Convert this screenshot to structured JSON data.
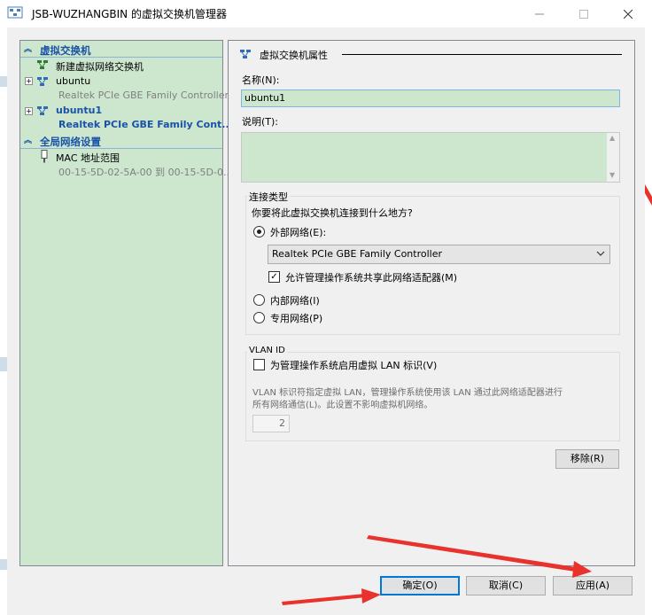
{
  "window": {
    "title": "JSB-WUZHANGBIN 的虚拟交换机管理器"
  },
  "left_panel": {
    "section1": {
      "label": "虚拟交换机"
    },
    "new_switch": {
      "label": "新建虚拟网络交换机"
    },
    "switches": [
      {
        "name": "ubuntu",
        "adapter": "Realtek PCIe GBE Family Controller"
      },
      {
        "name": "ubuntu1",
        "adapter": "Realtek PCIe GBE Family Cont..."
      }
    ],
    "section2": {
      "label": "全局网络设置"
    },
    "mac": {
      "label": "MAC 地址范围",
      "range": "00-15-5D-02-5A-00 到 00-15-5D-0..."
    }
  },
  "props": {
    "header": "虚拟交换机属性",
    "name_label": "名称(N):",
    "name_value": "ubuntu1",
    "desc_label": "说明(T):",
    "desc_value": "",
    "conn": {
      "title": "连接类型",
      "question": "你要将此虚拟交换机连接到什么地方?",
      "external": "外部网络(E):",
      "adapter_selected": "Realtek PCIe GBE Family Controller",
      "allow_mgmt": "允许管理操作系统共享此网络适配器(M)",
      "internal": "内部网络(I)",
      "private": "专用网络(P)",
      "selected": "external",
      "allow_mgmt_checked": true
    },
    "vlan": {
      "title": "VLAN ID",
      "enable": "为管理操作系统启用虚拟 LAN 标识(V)",
      "enable_checked": false,
      "desc_line1": "VLAN 标识符指定虚拟 LAN，管理操作系统使用该 LAN 通过此网络适配器进行",
      "desc_line2": "所有网络通信(L)。此设置不影响虚拟机网络。",
      "id_value": "2"
    },
    "remove": "移除(R)"
  },
  "buttons": {
    "ok": "确定(O)",
    "cancel": "取消(C)",
    "apply": "应用(A)"
  },
  "colors": {
    "panel_green": "#cde7cf",
    "header_blue": "#1a52a6",
    "annotation_red": "#e8322b"
  }
}
